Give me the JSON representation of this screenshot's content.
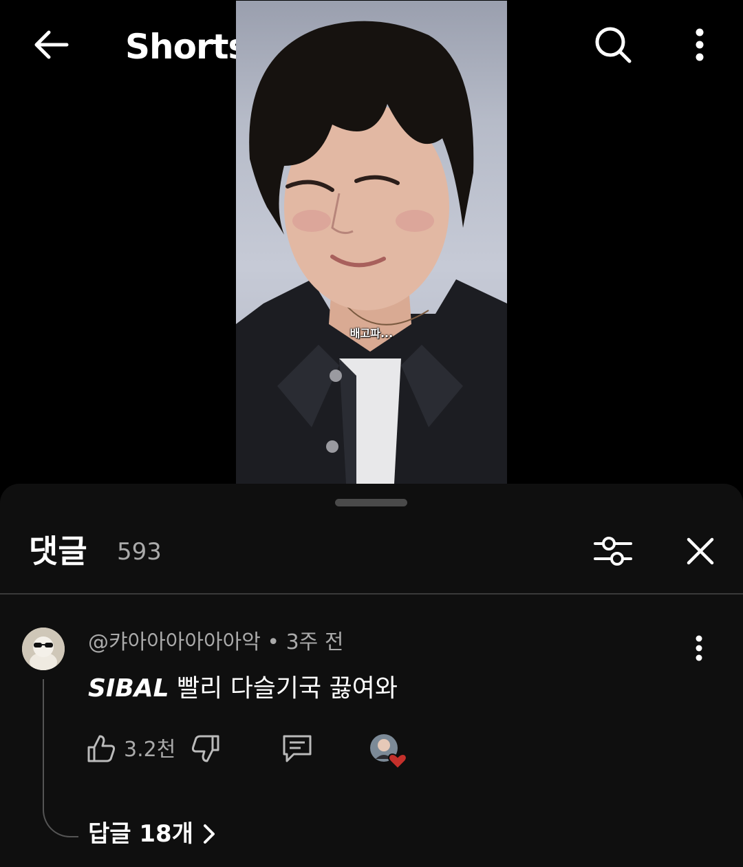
{
  "header": {
    "title": "Shorts",
    "back_icon": "arrow-left-icon",
    "search_icon": "search-icon",
    "more_icon": "more-vertical-icon"
  },
  "video": {
    "caption": "배고파..."
  },
  "comments": {
    "title": "댓글",
    "count": "593",
    "filter_icon": "sliders-icon",
    "close_icon": "close-icon",
    "items": [
      {
        "author": "@캬아아아아아아악",
        "time": "3주 전",
        "text_em": "SIBAL",
        "text_rest": " 빨리 다슬기국 끓여와",
        "likes": "3.2천",
        "replies_label": "답글 18개"
      }
    ]
  },
  "colors": {
    "background": "#000000",
    "sheet": "#0f0f0f",
    "muted_text": "#aaaaaa",
    "heart": "#c4302b"
  }
}
